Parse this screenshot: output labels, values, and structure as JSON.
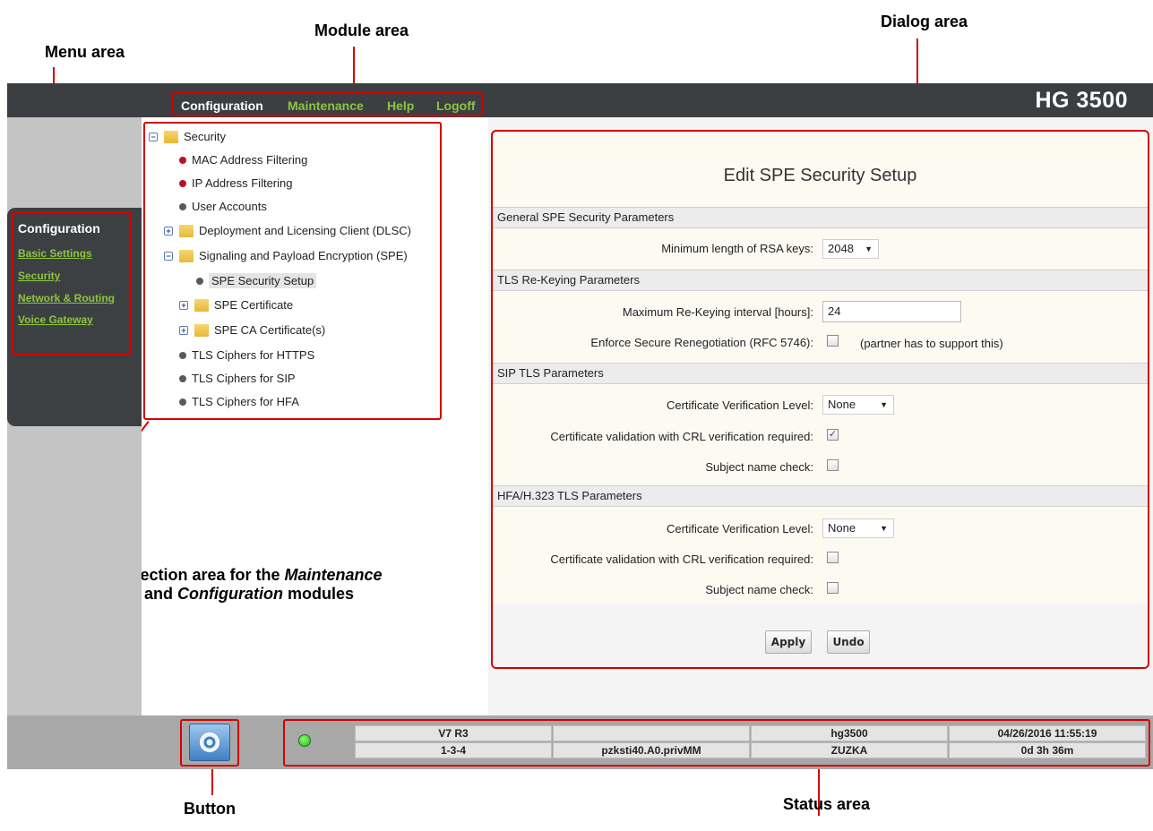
{
  "annotations": {
    "module_area": "Module area",
    "dialog_area": "Dialog area",
    "menu_area": "Menu area",
    "selection_area_line1_prefix": "Selection area for the ",
    "selection_area_line1_em": "Maintenance",
    "selection_area_line2_prefix": "and ",
    "selection_area_line2_em": "Configuration",
    "selection_area_line2_suffix": " modules",
    "button": "Button",
    "status_area": "Status area"
  },
  "header": {
    "modules": [
      {
        "label": "Configuration",
        "color": "#ffffff"
      },
      {
        "label": "Maintenance",
        "color": "#8bc53f"
      },
      {
        "label": "Help",
        "color": "#8bc53f"
      },
      {
        "label": "Logoff",
        "color": "#8bc53f"
      }
    ],
    "brand": "HG 3500"
  },
  "menu": {
    "title": "Configuration",
    "items": [
      "Basic Settings",
      "Security",
      "Network & Routing",
      "Voice Gateway"
    ]
  },
  "tree": {
    "root": "Security",
    "items": [
      {
        "label": "MAC Address Filtering",
        "icon": "red-bullet-icon"
      },
      {
        "label": "IP Address Filtering",
        "icon": "red-bullet-icon"
      },
      {
        "label": "User Accounts",
        "icon": "gray-bullet-icon"
      },
      {
        "label": "Deployment and Licensing Client (DLSC)",
        "icon": "folder-icon",
        "expander": "+"
      },
      {
        "label": "Signaling and Payload Encryption (SPE)",
        "icon": "folder-icon",
        "expander": "−"
      },
      {
        "label": "SPE Security Setup",
        "icon": "gray-bullet-icon",
        "selected": true
      },
      {
        "label": "SPE Certificate",
        "icon": "folder-icon",
        "expander": "+"
      },
      {
        "label": "SPE CA Certificate(s)",
        "icon": "folder-icon",
        "expander": "+"
      },
      {
        "label": "TLS Ciphers for HTTPS",
        "icon": "gray-bullet-icon"
      },
      {
        "label": "TLS Ciphers for SIP",
        "icon": "gray-bullet-icon"
      },
      {
        "label": "TLS Ciphers for HFA",
        "icon": "gray-bullet-icon"
      }
    ]
  },
  "dialog": {
    "title": "Edit SPE Security Setup",
    "general": {
      "header": "General SPE Security Parameters",
      "rsa_label": "Minimum length of RSA keys:",
      "rsa_value": "2048"
    },
    "tls_rekey": {
      "header": "TLS Re-Keying Parameters",
      "interval_label": "Maximum Re-Keying interval [hours]:",
      "interval_value": "24",
      "renegotiation_label": "Enforce Secure Renegotiation (RFC 5746):",
      "renegotiation_checked": false,
      "renegotiation_note": "(partner has to support this)"
    },
    "sip_tls": {
      "header": "SIP TLS Parameters",
      "verification_label": "Certificate Verification Level:",
      "verification_value": "None",
      "crl_label": "Certificate validation with CRL verification required:",
      "crl_checked": true,
      "subject_label": "Subject name check:",
      "subject_checked": false
    },
    "hfa_tls": {
      "header": "HFA/H.323 TLS Parameters",
      "verification_label": "Certificate Verification Level:",
      "verification_value": "None",
      "crl_label": "Certificate validation with CRL verification required:",
      "crl_checked": false,
      "subject_label": "Subject name check:",
      "subject_checked": false
    },
    "apply_label": "Apply",
    "undo_label": "Undo"
  },
  "status": {
    "version": "V7 R3",
    "empty": "",
    "hostname": "hg3500",
    "datetime": "04/26/2016 11:55:19",
    "slot": "1-3-4",
    "node": "pzksti40.A0.privMM",
    "name": "ZUZKA",
    "uptime": "0d 3h 36m",
    "led_color": "#10c210"
  }
}
